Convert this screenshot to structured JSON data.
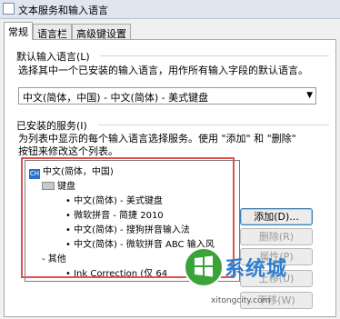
{
  "window": {
    "title": "文本服务和输入语言"
  },
  "tabs": [
    {
      "label": "常规"
    },
    {
      "label": "语言栏"
    },
    {
      "label": "高级键设置"
    }
  ],
  "default_language": {
    "heading": "默认输入语言(L)",
    "description": "选择其中一个已安装的输入语言，用作所有输入字段的默认语言。",
    "selected": "中文(简体，中国) - 中文(简体) - 美式键盘"
  },
  "installed_services": {
    "heading": "已安装的服务(I)",
    "description_line1": "为列表中显示的每个输入语言选择服务。使用 \"添加\" 和 \"删除\"",
    "description_line2": "按钮来修改这个列表。",
    "tree": {
      "language": "中文(简体，中国)",
      "language_icon_text": "CH",
      "keyboard_group": "键盘",
      "keyboards": [
        "中文(简体) - 美式键盘",
        "微软拼音 - 简捷 2010",
        "中文(简体) - 搜狗拼音输入法",
        "中文(简体) - 微软拼音 ABC 输入风"
      ],
      "other_group": "其他",
      "others": [
        "Ink Correction (仅 64"
      ]
    }
  },
  "buttons": {
    "add": "添加(D)...",
    "remove": "删除(R)",
    "properties": "属性(P)",
    "move_up": "上移(U)",
    "move_down": "下移(W)"
  },
  "watermark": {
    "brand": "系统城",
    "url": "xitongcity.com"
  }
}
